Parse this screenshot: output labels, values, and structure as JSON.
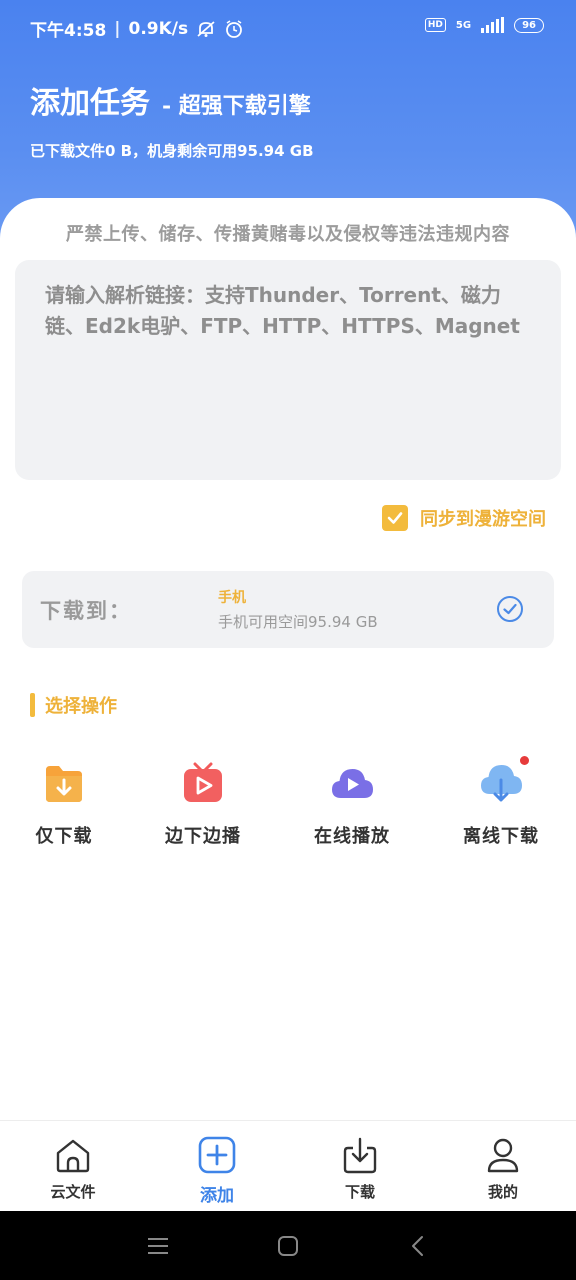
{
  "status_bar": {
    "time": "下午4:58",
    "net_speed": "0.9K/s",
    "hd": "HD",
    "network": "5G",
    "battery": "96"
  },
  "header": {
    "title": "添加任务",
    "subtitle": "- 超强下载引擎",
    "storage_info": "已下载文件0 B，机身剩余可用95.94 GB"
  },
  "warning": "严禁上传、储存、传播黄赌毒以及侵权等违法违规内容",
  "link_input": {
    "placeholder": "请输入解析链接：支持Thunder、Torrent、磁力链、Ed2k电驴、FTP、HTTP、HTTPS、Magnet",
    "value": ""
  },
  "sync": {
    "label": "同步到漫游空间",
    "checked": true
  },
  "destination": {
    "label": "下载到：",
    "device": "手机",
    "space": "手机可用空间95.94 GB"
  },
  "section": {
    "title": "选择操作"
  },
  "operations": [
    {
      "label": "仅下载",
      "icon": "folder-download-icon"
    },
    {
      "label": "边下边播",
      "icon": "tv-play-icon"
    },
    {
      "label": "在线播放",
      "icon": "cloud-play-icon"
    },
    {
      "label": "离线下载",
      "icon": "cloud-download-icon"
    }
  ],
  "bottom_nav": [
    {
      "label": "云文件",
      "icon": "home-icon",
      "active": false
    },
    {
      "label": "添加",
      "icon": "add-square-icon",
      "active": true
    },
    {
      "label": "下载",
      "icon": "download-tray-icon",
      "active": false
    },
    {
      "label": "我的",
      "icon": "user-icon",
      "active": false
    }
  ],
  "colors": {
    "header_blue": "#4a82ef",
    "accent_yellow": "#f3bb3d",
    "active_blue": "#3f84e8",
    "check_blue": "#4b8ae6"
  }
}
